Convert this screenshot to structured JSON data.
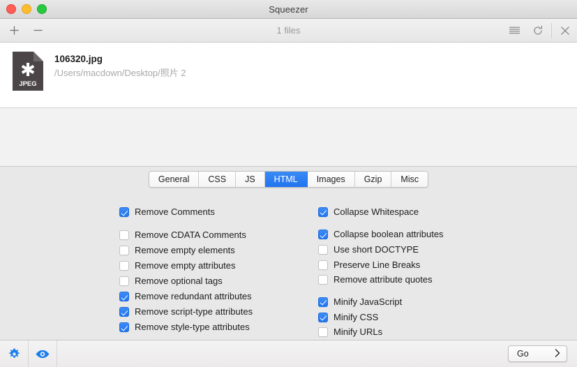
{
  "window": {
    "title": "Squeezer",
    "traffic_lights": [
      {
        "name": "close-button",
        "color": "#ff5f57"
      },
      {
        "name": "minimize-button",
        "color": "#ffbd2e"
      },
      {
        "name": "zoom-button",
        "color": "#28c940"
      }
    ]
  },
  "toolbar": {
    "add_label": "+",
    "remove_label": "−",
    "count_text": "1 files",
    "icons": [
      "list-icon",
      "refresh-icon",
      "close-icon"
    ]
  },
  "filelist": {
    "files": [
      {
        "name": "106320.jpg",
        "path": "/Users/macdown/Desktop/照片 2",
        "icon_type": "JPEG",
        "icon_glyph": "✱"
      }
    ]
  },
  "tabs": [
    {
      "label": "General",
      "active": false
    },
    {
      "label": "CSS",
      "active": false
    },
    {
      "label": "JS",
      "active": false
    },
    {
      "label": "HTML",
      "active": true
    },
    {
      "label": "Images",
      "active": false
    },
    {
      "label": "Gzip",
      "active": false
    },
    {
      "label": "Misc",
      "active": false
    }
  ],
  "settings": {
    "left_column": [
      {
        "label": "Remove Comments",
        "checked": true,
        "gap_after": true
      },
      {
        "label": "Remove CDATA Comments",
        "checked": false,
        "gap_after": false
      },
      {
        "label": "Remove empty elements",
        "checked": false,
        "gap_after": false
      },
      {
        "label": "Remove empty attributes",
        "checked": false,
        "gap_after": false
      },
      {
        "label": "Remove optional tags",
        "checked": false,
        "gap_after": false
      },
      {
        "label": "Remove redundant attributes",
        "checked": true,
        "gap_after": false
      },
      {
        "label": "Remove script-type attributes",
        "checked": true,
        "gap_after": false
      },
      {
        "label": "Remove style-type attributes",
        "checked": true,
        "gap_after": false
      }
    ],
    "right_column": [
      {
        "label": "Collapse Whitespace",
        "checked": true,
        "gap_after": true
      },
      {
        "label": "Collapse boolean attributes",
        "checked": true,
        "gap_after": false
      },
      {
        "label": "Use short DOCTYPE",
        "checked": false,
        "gap_after": false
      },
      {
        "label": "Preserve Line Breaks",
        "checked": false,
        "gap_after": false
      },
      {
        "label": "Remove attribute quotes",
        "checked": false,
        "gap_after": true
      },
      {
        "label": "Minify JavaScript",
        "checked": true,
        "gap_after": false
      },
      {
        "label": "Minify CSS",
        "checked": true,
        "gap_after": false
      },
      {
        "label": "Minify URLs",
        "checked": false,
        "gap_after": false
      }
    ]
  },
  "bottombar": {
    "settings_icon": "gear-icon",
    "preview_icon": "eye-icon",
    "go_label": "Go",
    "go_chevron": "›",
    "accent_color": "#1a7ef0"
  }
}
